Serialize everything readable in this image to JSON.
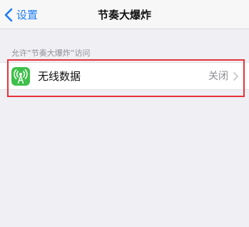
{
  "nav": {
    "back_label": "设置",
    "title": "节奏大爆炸"
  },
  "section": {
    "header": "允许“节奏大爆炸”访问"
  },
  "cell": {
    "label": "无线数据",
    "value": "关闭",
    "icon": "antenna-icon"
  },
  "colors": {
    "accent": "#1c7cf4",
    "icon_green": "#3ec04a",
    "highlight": "#e8323a"
  }
}
